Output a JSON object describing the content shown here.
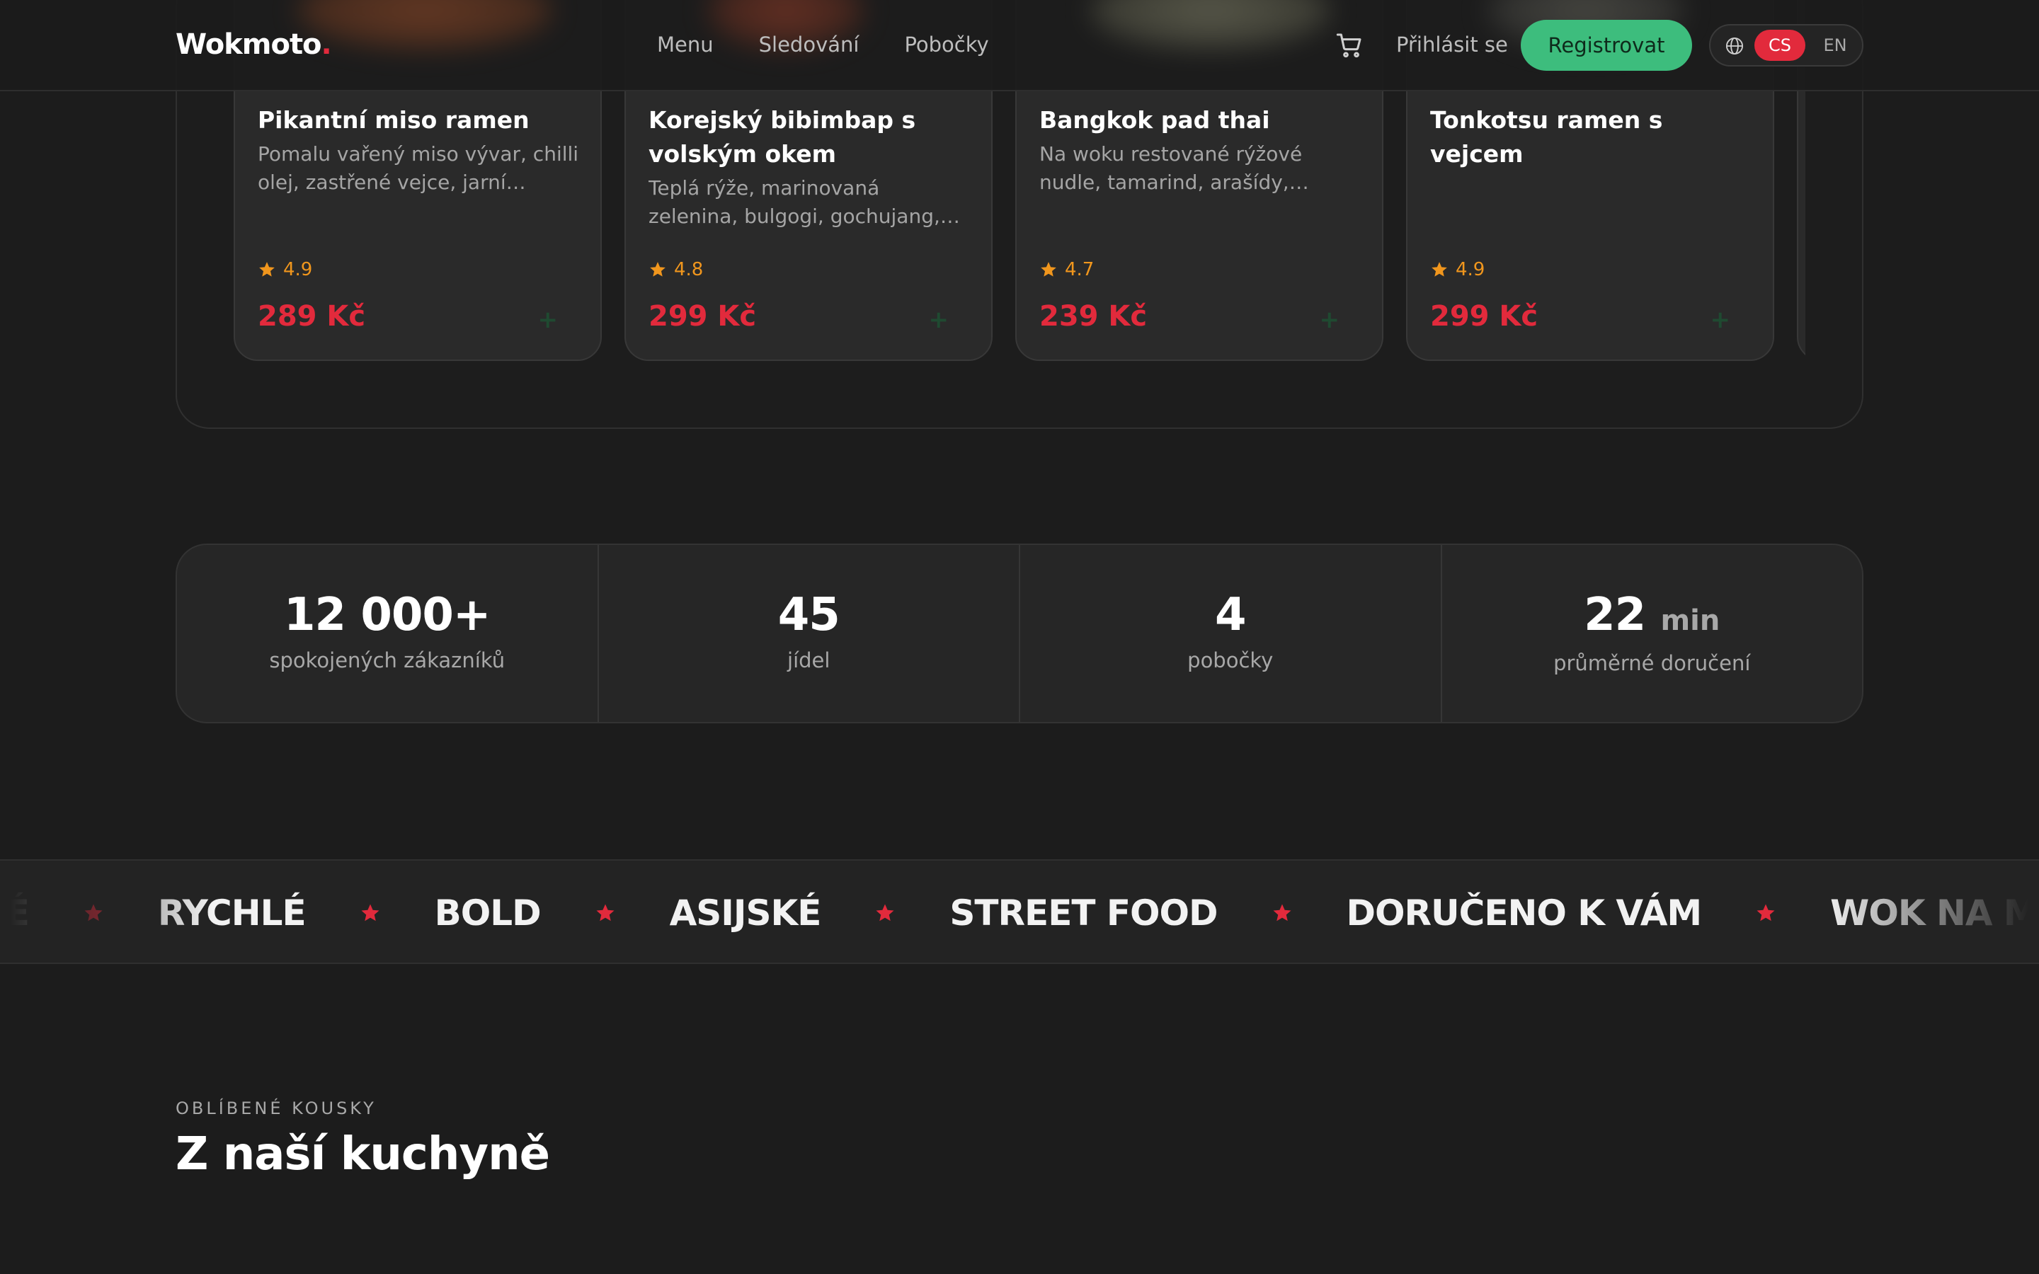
{
  "header": {
    "logo_text": "Wokmoto",
    "logo_dot": ".",
    "nav": [
      {
        "label": "Menu"
      },
      {
        "label": "Sledování"
      },
      {
        "label": "Pobočky"
      }
    ],
    "login_label": "Přihlásit se",
    "register_label": "Registrovat",
    "lang_active": "CS",
    "lang_other": "EN",
    "icons": {
      "cart": "cart-icon",
      "globe": "globe-icon"
    }
  },
  "menu_cards": [
    {
      "name": "Pikantní miso ramen",
      "description": "Pomalu vařený miso vývar, chilli olej, zastřené vejce, jarní cibulka.",
      "rating": "4.9",
      "price": "289 Kč",
      "add": "+"
    },
    {
      "name": "Korejský bibimbap s volským okem",
      "description": "Teplá rýže, marinovaná zelenina, bulgogi, gochujang,…",
      "rating": "4.8",
      "price": "299 Kč",
      "add": "+"
    },
    {
      "name": "Bangkok pad thai",
      "description": "Na woku restované rýžové nudle, tamarind, arašídy,…",
      "rating": "4.7",
      "price": "239 Kč",
      "add": "+"
    },
    {
      "name": "Tonkotsu ramen s vejcem",
      "description": "",
      "rating": "4.9",
      "price": "299 Kč",
      "add": "+"
    }
  ],
  "stats": [
    {
      "value": "12 000+",
      "unit": "",
      "label": "spokojených zákazníků"
    },
    {
      "value": "45",
      "unit": "",
      "label": "jídel"
    },
    {
      "value": "4",
      "unit": "",
      "label": "pobočky"
    },
    {
      "value": "22",
      "unit": "min",
      "label": "průměrné doručení"
    }
  ],
  "marquee": {
    "words": [
      "Vé",
      "Rychlé",
      "Bold",
      "Asijské",
      "Street food",
      "Doručeno k vám",
      "Wok na maximum"
    ]
  },
  "section": {
    "eyebrow": "Oblíbené kousky",
    "title": "Z naší kuchyně"
  },
  "colors": {
    "accent_red": "#e22a3c",
    "accent_green": "#3dbd7d",
    "rating_orange": "#f0961d",
    "background": "#1c1c1c"
  }
}
